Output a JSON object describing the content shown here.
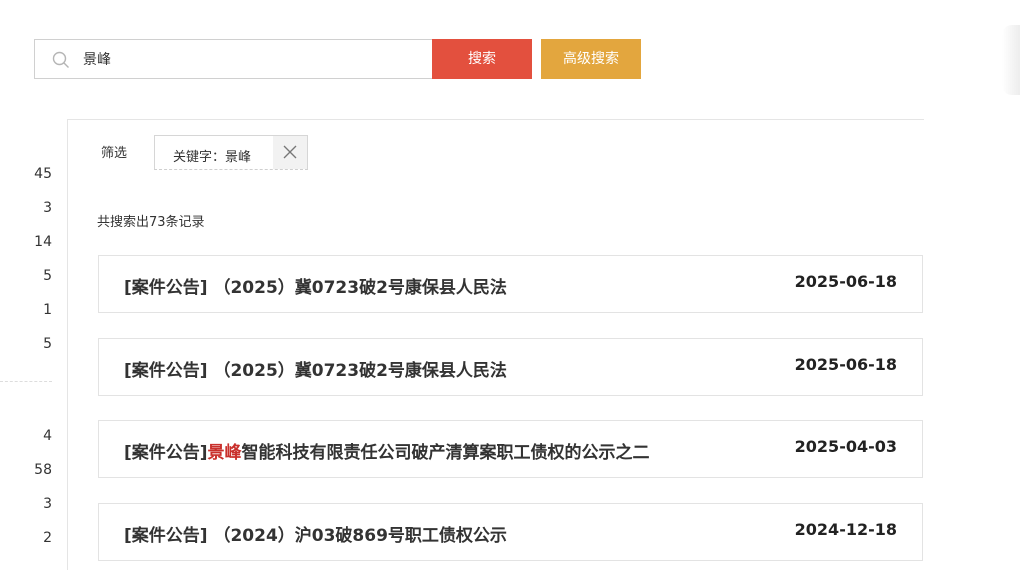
{
  "search": {
    "value": "景峰",
    "placeholder": "",
    "search_label": "搜索",
    "advanced_label": "高级搜索"
  },
  "colors": {
    "search_button": "#e3503e",
    "advanced_button": "#e3a63e",
    "highlight": "#c9302c"
  },
  "left_counts": {
    "group1": [
      "45",
      "3",
      "14",
      "5",
      "1",
      "5"
    ],
    "group2": [
      "4",
      "58",
      "3",
      "2"
    ]
  },
  "filter": {
    "label": "筛选",
    "tag": "关键字：景峰"
  },
  "result_summary": "共搜索出73条记录",
  "results": [
    {
      "prefix": "[案件公告]",
      "highlight": "",
      "title": " （2025）冀0723破2号康保县人民法",
      "date": "2025-06-18"
    },
    {
      "prefix": "[案件公告]",
      "highlight": "",
      "title": " （2025）冀0723破2号康保县人民法",
      "date": "2025-06-18"
    },
    {
      "prefix": "[案件公告]",
      "highlight": "景峰",
      "title": "智能科技有限责任公司破产清算案职工债权的公示之二",
      "date": "2025-04-03"
    },
    {
      "prefix": "[案件公告]",
      "highlight": "",
      "title": " （2024）沪03破869号职工债权公示",
      "date": "2024-12-18"
    }
  ]
}
